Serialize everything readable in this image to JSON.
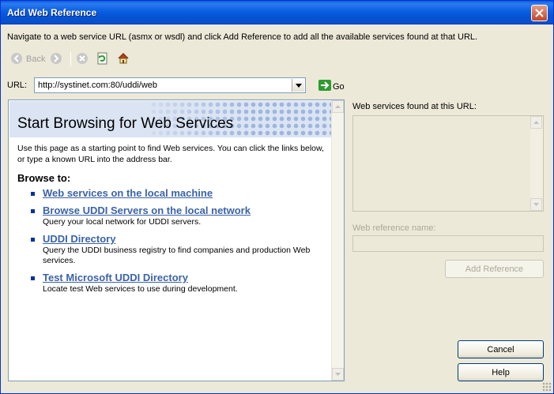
{
  "window": {
    "title": "Add Web Reference"
  },
  "instruction": "Navigate to a web service URL (asmx or wsdl) and click Add Reference to add all the available services found at that URL.",
  "toolbar": {
    "back_label": "Back",
    "go_label": "Go",
    "icons": [
      "back-arrow-icon",
      "forward-arrow-icon",
      "stop-icon",
      "refresh-icon",
      "home-icon",
      "go-arrow-icon"
    ]
  },
  "url": {
    "label": "URL:",
    "value": "http://systinet.com:80/uddi/web"
  },
  "browser": {
    "heading": "Start Browsing for Web Services",
    "intro": "Use this page as a starting point to find Web services. You can click the links below, or type a known URL into the address bar.",
    "browse_to": "Browse to:",
    "links": [
      {
        "label": "Web services on the local machine",
        "description": ""
      },
      {
        "label": "Browse UDDI Servers on the local network",
        "description": "Query your local network for UDDI servers."
      },
      {
        "label": "UDDI Directory",
        "description": "Query the UDDI business registry to find companies and production Web services."
      },
      {
        "label": "Test Microsoft UDDI Directory",
        "description": "Locate test Web services to use during development."
      }
    ]
  },
  "right_panel": {
    "found_label": "Web services found at this URL:",
    "reference_name_label": "Web reference name:",
    "reference_name_value": "",
    "add_reference_label": "Add Reference"
  },
  "buttons": {
    "cancel_label": "Cancel",
    "help_label": "Help"
  },
  "colors": {
    "titlebar": "#0a5fe3",
    "link": "#3b63a8",
    "face": "#ece9d8"
  }
}
